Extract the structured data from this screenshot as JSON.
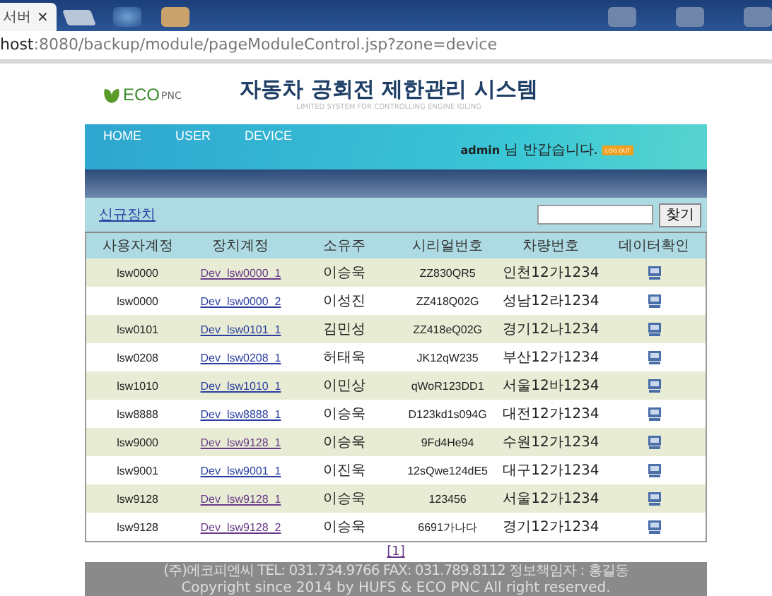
{
  "browser": {
    "tab_title": "서버",
    "tab_close": "×",
    "url_host": "host",
    "url_rest": ":8080/backup/module/pageModuleControl.jsp?zone=device"
  },
  "header": {
    "logo_text": "ECO",
    "logo_suffix": "PNC",
    "title": "자동차 공회전 제한관리 시스템",
    "subtitle": "LIMITED SYSTEM FOR CONTROLLING ENGINE IDLING"
  },
  "nav": {
    "items": [
      "HOME",
      "USER",
      "DEVICE"
    ],
    "user": "admin",
    "greeting": "님 반갑습니다.",
    "logout": "LOG OUT"
  },
  "toolbar": {
    "new_link": "신규장치",
    "search_button": "찾기"
  },
  "table": {
    "columns": [
      "사용자계정",
      "장치계정",
      "소유주",
      "시리얼번호",
      "차량번호",
      "데이터확인"
    ],
    "rows": [
      {
        "user": "lsw0000",
        "device": "Dev_lsw0000_1",
        "visited": true,
        "owner": "이승욱",
        "serial": "ZZ830QR5",
        "plate": "인천12가1234"
      },
      {
        "user": "lsw0000",
        "device": "Dev_lsw0000_2",
        "visited": false,
        "owner": "이성진",
        "serial": "ZZ418Q02G",
        "plate": "성남12라1234"
      },
      {
        "user": "lsw0101",
        "device": "Dev_lsw0101_1",
        "visited": false,
        "owner": "김민성",
        "serial": "ZZ418eQ02G",
        "plate": "경기12나1234"
      },
      {
        "user": "lsw0208",
        "device": "Dev_lsw0208_1",
        "visited": false,
        "owner": "허태욱",
        "serial": "JK12qW235",
        "plate": "부산12가1234"
      },
      {
        "user": "lsw1010",
        "device": "Dev_lsw1010_1",
        "visited": false,
        "owner": "이민상",
        "serial": "qWoR123DD1",
        "plate": "서울12바1234"
      },
      {
        "user": "lsw8888",
        "device": "Dev_lsw8888_1",
        "visited": false,
        "owner": "이승욱",
        "serial": "D123kd1s094G",
        "plate": "대전12가1234"
      },
      {
        "user": "lsw9000",
        "device": "Dev_lsw9128_1",
        "visited": true,
        "owner": "이승욱",
        "serial": "9Fd4He94",
        "plate": "수원12가1234"
      },
      {
        "user": "lsw9001",
        "device": "Dev_lsw9001_1",
        "visited": false,
        "owner": "이진욱",
        "serial": "12sQwe124dE5",
        "plate": "대구12가1234"
      },
      {
        "user": "lsw9128",
        "device": "Dev_lsw9128_1",
        "visited": true,
        "owner": "이승욱",
        "serial": "123456",
        "plate": "서울12가1234"
      },
      {
        "user": "lsw9128",
        "device": "Dev_lsw9128_2",
        "visited": true,
        "owner": "이승욱",
        "serial": "6691가나다",
        "plate": "경기12가1234"
      }
    ]
  },
  "pagination": [
    "[1]"
  ],
  "footer": {
    "contact": "(주)에코피엔씨   TEL: 031.734.9766   FAX: 031.789.8112   정보책임자 : 홍길동",
    "copyright": "Copyright since 2014 by HUFS & ECO PNC All right reserved."
  }
}
